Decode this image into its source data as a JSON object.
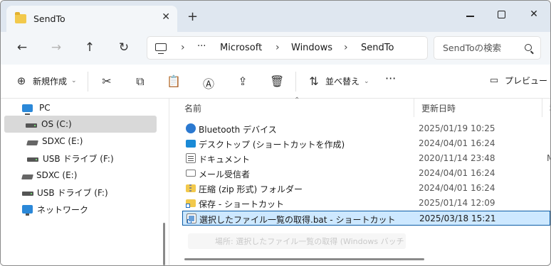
{
  "tab": {
    "title": "SendTo",
    "close": "✕",
    "new_tab": "+"
  },
  "window_controls": {
    "minimize": "",
    "maximize": "",
    "close": "✕"
  },
  "nav": {
    "back": "←",
    "forward": "→",
    "up": "↑",
    "refresh": "↻"
  },
  "address": {
    "more": "···",
    "crumbs": [
      "Microsoft",
      "Windows",
      "SendTo"
    ],
    "separator": "›"
  },
  "search": {
    "placeholder": "SendToの検索"
  },
  "commands": {
    "new": "新規作成",
    "sort": "並べ替え",
    "more": "···",
    "preview": "プレビュー"
  },
  "tree": {
    "items": [
      {
        "label": "PC",
        "icon": "pc-icon"
      },
      {
        "label": "OS (C:)",
        "icon": "drive-icon",
        "selected": true
      },
      {
        "label": "SDXC (E:)",
        "icon": "sd-card-icon"
      },
      {
        "label": "USB ドライブ (F:)",
        "icon": "usb-drive-icon"
      },
      {
        "label": "SDXC (E:)",
        "icon": "sd-card-icon"
      },
      {
        "label": "USB ドライブ (F:)",
        "icon": "usb-drive-icon"
      },
      {
        "label": "ネットワーク",
        "icon": "network-icon"
      }
    ]
  },
  "columns": {
    "name": "名前",
    "modified": "更新日時",
    "extra": "種"
  },
  "files": [
    {
      "name": "Bluetooth デバイス",
      "date": "2025/01/19 10:25",
      "extra": "",
      "icon": "bluetooth-icon"
    },
    {
      "name": "デスクトップ (ショートカットを作成)",
      "date": "2024/04/01 16:24",
      "extra": "",
      "icon": "desktop-icon"
    },
    {
      "name": "ドキュメント",
      "date": "2020/11/14 23:48",
      "extra": "M",
      "icon": "document-icon"
    },
    {
      "name": "メール受信者",
      "date": "2024/04/01 16:24",
      "extra": "",
      "icon": "mail-icon"
    },
    {
      "name": "圧縮 (zip 形式) フォルダー",
      "date": "2024/04/01 16:24",
      "extra": "",
      "icon": "zip-folder-icon"
    },
    {
      "name": "保存 - ショートカット",
      "date": "2025/01/14 12:09",
      "extra": "",
      "icon": "folder-shortcut-icon"
    },
    {
      "name": "選択したファイル一覧の取得.bat - ショートカット",
      "date": "2025/03/18 15:21",
      "extra": "",
      "icon": "bat-shortcut-icon",
      "selected": true
    }
  ],
  "tooltip": "場所: 選択したファイル一覧の取得 (Windows バッチ ファイル)"
}
